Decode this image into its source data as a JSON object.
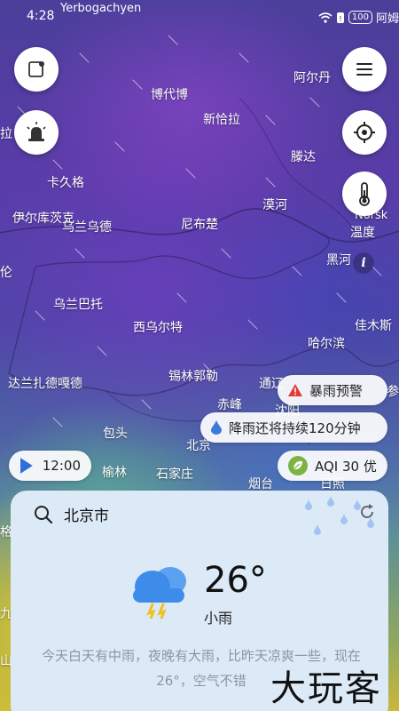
{
  "status_bar": {
    "time": "4:28",
    "location_overlay": "Yerbogachyen",
    "battery": "100",
    "carrier": "阿姆"
  },
  "map": {
    "cities": [
      "博代博",
      "阿尔丹",
      "新恰拉",
      "拉",
      "滕达",
      "卡久格",
      "伊尔库茨克",
      "乌兰乌德",
      "尼布楚",
      "漠河",
      "Norsk",
      "温度",
      "黑河",
      "伦",
      "乌兰巴托",
      "西乌尔特",
      "佳木斯",
      "哈尔滨",
      "锡林郭勒",
      "达兰扎德嘎德",
      "赤峰",
      "通辽",
      "沈阳",
      "参",
      "包头",
      "北京",
      "榆林",
      "石家庄",
      "烟台",
      "日照",
      "格",
      "九",
      "山"
    ]
  },
  "buttons": {
    "info_icon": "i"
  },
  "alerts": {
    "storm_warning": "暴雨预警",
    "rain_duration": "降雨还将持续120分钟",
    "aqi": "AQI 30 优"
  },
  "playback": {
    "time": "12:00"
  },
  "weather": {
    "city": "北京市",
    "temperature": "26°",
    "condition": "小雨",
    "summary": "今天白天有中雨，夜晚有大雨，比昨天凉爽一些，现在26°，空气不错"
  },
  "watermark": "大玩客",
  "colors": {
    "storm_red": "#e53935",
    "rain_blue": "#3a7bd5",
    "aqi_green": "#7cb342",
    "play_blue": "#2f6fd6"
  }
}
